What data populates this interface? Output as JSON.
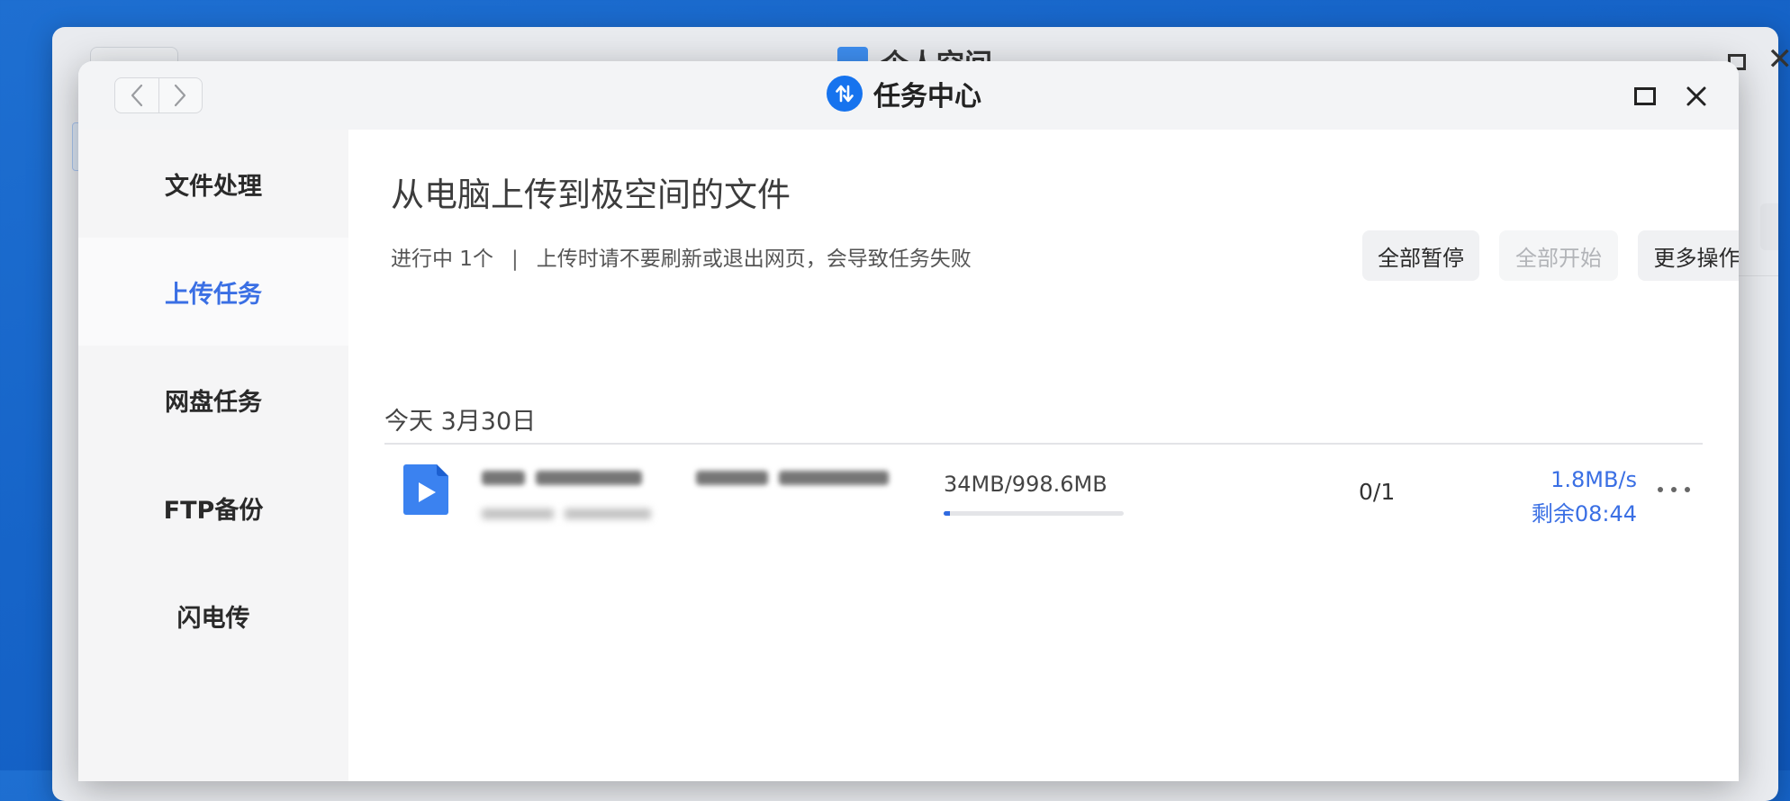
{
  "background_window": {
    "title": "个人空间"
  },
  "dialog": {
    "title": "任务中心",
    "app_icon": "transfer-arrows-icon",
    "nav": {
      "back_icon": "chevron-left-icon",
      "forward_icon": "chevron-right-icon"
    },
    "window_buttons": {
      "maximize_icon": "maximize-icon",
      "close_icon": "close-icon"
    }
  },
  "sidebar": {
    "items": [
      {
        "label": "文件处理",
        "active": false
      },
      {
        "label": "上传任务",
        "active": true
      },
      {
        "label": "网盘任务",
        "active": false
      },
      {
        "label": "FTP备份",
        "active": false
      },
      {
        "label": "闪电传",
        "active": false
      }
    ]
  },
  "main": {
    "heading": "从电脑上传到极空间的文件",
    "status_count": "进行中 1个",
    "separator": "|",
    "warning": "上传时请不要刷新或退出网页，会导致任务失败",
    "buttons": {
      "pause_all": "全部暂停",
      "start_all": "全部开始",
      "more_actions": "更多操作"
    },
    "date_group": "今天 3月30日",
    "tasks": [
      {
        "file_icon": "video-file-icon",
        "size_text": "34MB/998.6MB",
        "progress": 0.034,
        "count": "0/1",
        "speed": "1.8MB/s",
        "remaining": "剩余08:44",
        "more_icon": "more-dots-icon"
      }
    ]
  },
  "colors": {
    "accent": "#3a6fe4",
    "desktop_blue": "#1664c8",
    "progress": "#2f6ae0",
    "file_icon": "#3b82f0"
  }
}
